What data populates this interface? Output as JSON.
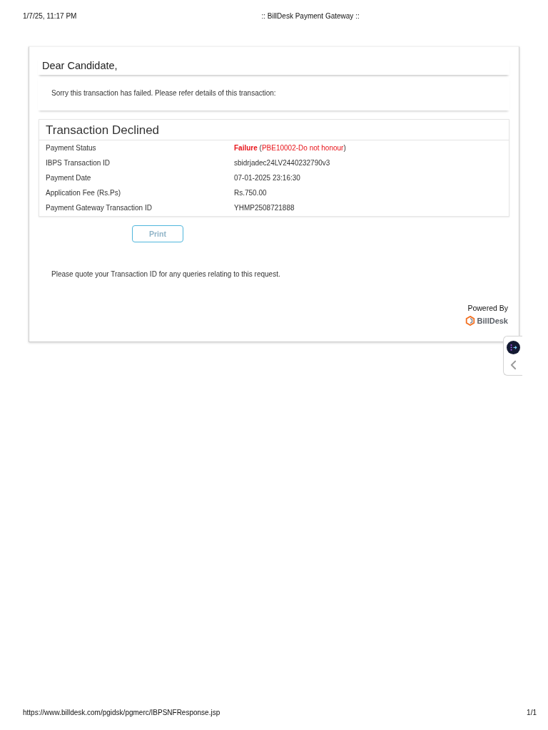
{
  "print_header": {
    "date_time": "1/7/25, 11:17 PM",
    "page_title": ":: BillDesk Payment Gateway ::"
  },
  "greeting": "Dear Candidate,",
  "message": "Sorry this transaction has failed. Please refer details of this transaction:",
  "transaction_panel": {
    "title": "Transaction Declined",
    "rows": [
      {
        "label": "Payment Status",
        "value_parts": [
          {
            "text": "**Failure** ",
            "error": true
          },
          {
            "text": "(",
            "error": false
          },
          {
            "text": "PBE10002-Do not honour",
            "error": true
          },
          {
            "text": ")",
            "error": false
          }
        ]
      },
      {
        "label": "IBPS Transaction ID",
        "value": "sbidrjadec24LV2440232790v3"
      },
      {
        "label": "Payment Date",
        "value": "07-01-2025 23:16:30"
      },
      {
        "label": "Application Fee (Rs.Ps)",
        "value": "Rs.750.00"
      },
      {
        "label": "Payment Gateway Transaction ID",
        "value": "YHMP2508721888"
      }
    ]
  },
  "print_button": {
    "label": "Print"
  },
  "note": "Please quote your Transaction ID for any queries relating to this request.",
  "powered_by": {
    "caption": "Powered By",
    "brand": "BillDesk"
  },
  "print_footer": {
    "url": "https://www.billdesk.com/pgidsk/pgmerc/IBPSNFResponse.jsp",
    "page_number": "1/1"
  }
}
